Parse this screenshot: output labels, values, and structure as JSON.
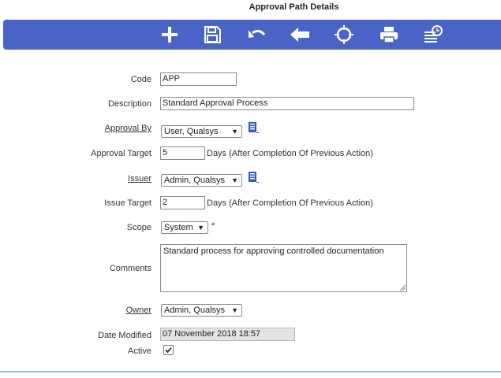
{
  "page": {
    "title": "Approval Path Details"
  },
  "toolbar": {
    "icons": [
      "plus-icon",
      "save-icon",
      "undo-icon",
      "back-arrow-icon",
      "locate-icon",
      "print-icon",
      "history-icon"
    ],
    "color": "#4a63c7"
  },
  "form": {
    "code": {
      "label": "Code",
      "value": "APP"
    },
    "description": {
      "label": "Description",
      "value": "Standard Approval Process"
    },
    "approval_by": {
      "label": "Approval By",
      "value": "User, Qualsys"
    },
    "approval_target": {
      "label": "Approval Target",
      "value": "5",
      "suffix": "Days (After Completion Of Previous Action)"
    },
    "issuer": {
      "label": "Issuer",
      "value": "Admin, Qualsys"
    },
    "issue_target": {
      "label": "Issue Target",
      "value": "2",
      "suffix": "Days (After Completion Of Previous Action)"
    },
    "scope": {
      "label": "Scope",
      "value": "System",
      "required_mark": "*"
    },
    "comments": {
      "label": "Comments",
      "value": "Standard process for approving controlled documentation"
    },
    "owner": {
      "label": "Owner",
      "value": "Admin, Qualsys"
    },
    "date_modified": {
      "label": "Date Modified",
      "value": "07 November 2018 18:57"
    },
    "active": {
      "label": "Active",
      "checked": true
    }
  }
}
